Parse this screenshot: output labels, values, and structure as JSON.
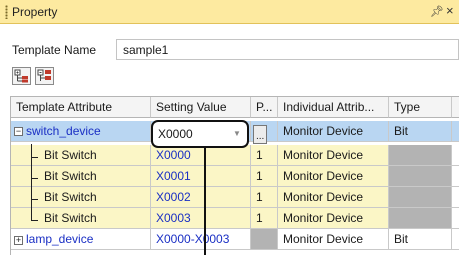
{
  "panel": {
    "title": "Property",
    "pin_glyph": "p",
    "close_glyph": "×"
  },
  "template_name": {
    "label": "Template Name",
    "value": "sample1"
  },
  "toolbar": {
    "icons": [
      "expand-all-icon",
      "collapse-all-icon"
    ]
  },
  "grid": {
    "headers": {
      "attribute": "Template Attribute",
      "setting": "Setting Value",
      "p": "P...",
      "individual": "Individual Attrib...",
      "type": "Type"
    },
    "rows": [
      {
        "attribute": "switch_device",
        "setting": "X0000",
        "p": "",
        "individual": "Monitor Device",
        "type": "Bit"
      },
      {
        "attribute": "Bit Switch",
        "setting": "X0000",
        "p": "1",
        "individual": "Monitor Device",
        "type": ""
      },
      {
        "attribute": "Bit Switch",
        "setting": "X0001",
        "p": "1",
        "individual": "Monitor Device",
        "type": ""
      },
      {
        "attribute": "Bit Switch",
        "setting": "X0002",
        "p": "1",
        "individual": "Monitor Device",
        "type": ""
      },
      {
        "attribute": "Bit Switch",
        "setting": "X0003",
        "p": "1",
        "individual": "Monitor Device",
        "type": ""
      },
      {
        "attribute": "lamp_device",
        "setting": "X0000-X0003",
        "p": "",
        "individual": "Monitor Device",
        "type": "Bit"
      }
    ],
    "expander_collapsed": "−",
    "expander_expanded": "+"
  },
  "colors": {
    "titlebar": "#fdeaa0",
    "selected_row": "#b9d6f2",
    "child_row": "#fbf6c6",
    "disabled_cell": "#b3b3b3",
    "device_text": "#1a2fc4"
  }
}
